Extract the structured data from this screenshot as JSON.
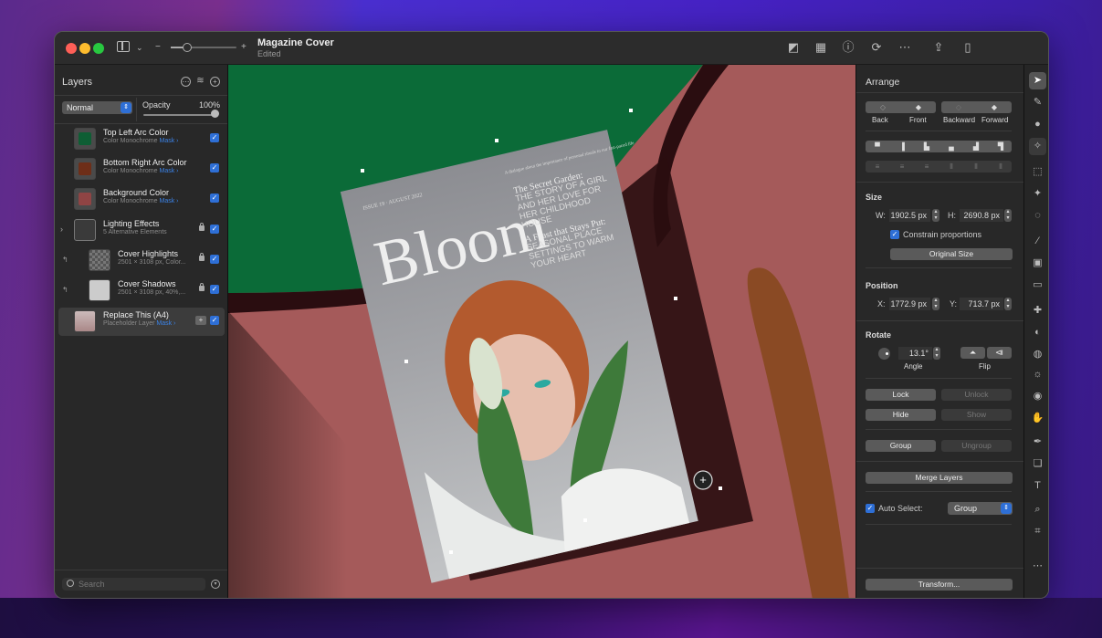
{
  "window": {
    "title": "Magazine Cover",
    "subtitle": "Edited",
    "zoom_slider_value": 0.25,
    "zoom_minus_icon": "−",
    "zoom_plus_icon": "+"
  },
  "toolbar_right": [
    {
      "name": "color-picker-icon",
      "glyph": "◩"
    },
    {
      "name": "color-palette-icon",
      "glyph": "▦"
    },
    {
      "name": "info-icon",
      "glyph": "ⓘ"
    },
    {
      "name": "rotate-icon",
      "glyph": "⟳"
    },
    {
      "name": "more-icon",
      "glyph": "⋯"
    },
    {
      "name": "share-icon",
      "glyph": "⇪"
    },
    {
      "name": "sidebar-right-icon",
      "glyph": "▯"
    }
  ],
  "layers_panel": {
    "title": "Layers",
    "blend_mode": "Normal",
    "opacity_label": "Opacity",
    "opacity_value": "100%",
    "opacity_fraction": 1.0,
    "search_placeholder": "Search",
    "layers": [
      {
        "name": "Top Left Arc Color",
        "sub": "Color Monochrome",
        "mask": "Mask ›",
        "swatch": "#0e5e34",
        "visible": true
      },
      {
        "name": "Bottom Right Arc Color",
        "sub": "Color Monochrome",
        "mask": "Mask ›",
        "swatch": "#6e2e18",
        "visible": true
      },
      {
        "name": "Background Color",
        "sub": "Color Monochrome",
        "mask": "Mask ›",
        "swatch": "#8f4444",
        "visible": true
      },
      {
        "name": "Lighting Effects",
        "sub": "5 Alternative Elements",
        "mask": "",
        "locked": true,
        "visible": true,
        "group": true
      },
      {
        "name": "Cover Highlights",
        "sub": "2501 × 3108 px, Color...",
        "mask": "",
        "locked": true,
        "visible": true
      },
      {
        "name": "Cover Shadows",
        "sub": "2501 × 3108 px, 40%,...",
        "mask": "",
        "locked": true,
        "visible": true
      },
      {
        "name": "Replace This (A4)",
        "sub": "Placeholder Layer",
        "mask": "Mask ›",
        "visible": true,
        "selected": true
      }
    ]
  },
  "canvas": {
    "cover": {
      "issue_line": "ISSUE 19 · AUGUST 2022",
      "title": "Bloom",
      "teaser_top": "A dialogue about the importance of personal rituals in our fast-paced life",
      "story1_title": "The Secret Garden:",
      "story1_body": "THE STORY OF A GIRL AND HER LOVE FOR HER CHILDHOOD HOUSE",
      "story2_title": "A Feast that Stays Put:",
      "story2_body": "SEASONAL PLACE SETTINGS TO WARM YOUR HEART"
    },
    "colors": {
      "green": "#0b6b38",
      "pink": "#a55a5a",
      "dark": "#2a0d10",
      "brown": "#8a4a24"
    }
  },
  "arrange": {
    "title": "Arrange",
    "order_buttons": [
      "Back",
      "Front",
      "Backward",
      "Forward"
    ],
    "size_title": "Size",
    "w_label": "W:",
    "w_value": "1902.5 px",
    "h_label": "H:",
    "h_value": "2690.8 px",
    "constrain_label": "Constrain proportions",
    "constrain_checked": true,
    "original_size": "Original Size",
    "position_title": "Position",
    "x_label": "X:",
    "x_value": "1772.9 px",
    "y_label": "Y:",
    "y_value": "713.7 px",
    "rotate_title": "Rotate",
    "angle_value": "13.1°",
    "angle_caption": "Angle",
    "flip_caption": "Flip",
    "lock": "Lock",
    "unlock": "Unlock",
    "hide": "Hide",
    "show": "Show",
    "group": "Group",
    "ungroup": "Ungroup",
    "merge": "Merge Layers",
    "auto_select_label": "Auto Select:",
    "auto_select_checked": true,
    "auto_select_value": "Group",
    "transform": "Transform..."
  },
  "tools": [
    {
      "name": "arrow-tool-icon",
      "glyph": "➤",
      "active": true
    },
    {
      "name": "paint-tool-icon",
      "glyph": "✎"
    },
    {
      "name": "smudge-tool-icon",
      "glyph": "●"
    },
    {
      "name": "warp-tool-icon",
      "glyph": "✧",
      "sub": true
    },
    {
      "name": "rect-select-tool-icon",
      "glyph": "⬚"
    },
    {
      "name": "magic-wand-tool-icon",
      "glyph": "✦"
    },
    {
      "name": "lasso-tool-icon",
      "glyph": "◌"
    },
    {
      "name": "brush-tool-icon",
      "glyph": "⁄"
    },
    {
      "name": "bucket-tool-icon",
      "glyph": "▣"
    },
    {
      "name": "eraser-tool-icon",
      "glyph": "▭"
    },
    {
      "name": "bandage-tool-icon",
      "glyph": "✚"
    },
    {
      "name": "clone-tool-icon",
      "glyph": "◐"
    },
    {
      "name": "blur-tool-icon",
      "glyph": "◍"
    },
    {
      "name": "lighten-tool-icon",
      "glyph": "☼"
    },
    {
      "name": "sponge-tool-icon",
      "glyph": "◉"
    },
    {
      "name": "hand-tool-icon",
      "glyph": "✋"
    },
    {
      "name": "pen-tool-icon",
      "glyph": "✒"
    },
    {
      "name": "shape-tool-icon",
      "glyph": "❏"
    },
    {
      "name": "text-tool-icon",
      "glyph": "T"
    },
    {
      "name": "zoom-tool-icon",
      "glyph": "⌕"
    },
    {
      "name": "crop-tool-icon",
      "glyph": "⌗"
    },
    {
      "name": "more-tools-icon",
      "glyph": "⋯"
    }
  ]
}
